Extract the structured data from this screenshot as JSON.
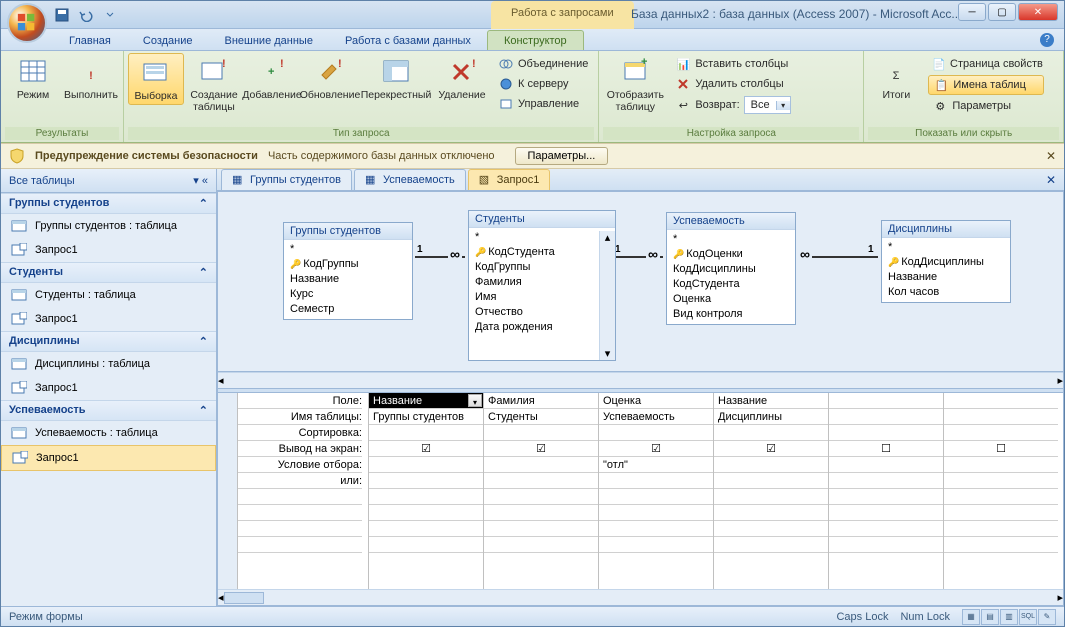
{
  "title_bar": {
    "context_tab": "Работа с запросами",
    "app_title": "База данных2 : база данных (Access 2007) - Microsoft Acc..."
  },
  "ribbon_tabs": [
    "Главная",
    "Создание",
    "Внешние данные",
    "Работа с базами данных",
    "Конструктор"
  ],
  "ribbon_active_tab": 4,
  "ribbon": {
    "group_results": {
      "label": "Результаты",
      "mode": "Режим",
      "run": "Выполнить"
    },
    "group_querytype": {
      "label": "Тип запроса",
      "select": "Выборка",
      "maketable": "Создание таблицы",
      "append": "Добавление",
      "update": "Обновление",
      "crosstab": "Перекрестный",
      "delete": "Удаление",
      "union": "Объединение",
      "passthrough": "К серверу",
      "ddl": "Управление"
    },
    "group_setup": {
      "label": "Настройка запроса",
      "showtable": "Отобразить таблицу",
      "insertcols": "Вставить столбцы",
      "deletecols": "Удалить столбцы",
      "return": "Возврат:",
      "return_val": "Все"
    },
    "group_showhide": {
      "label": "Показать или скрыть",
      "totals": "Итоги",
      "propsheet": "Страница свойств",
      "tablenames": "Имена таблиц",
      "params": "Параметры"
    }
  },
  "security": {
    "heading": "Предупреждение системы безопасности",
    "text": "Часть содержимого базы данных отключено",
    "btn": "Параметры..."
  },
  "nav": {
    "header": "Все таблицы",
    "groups": [
      {
        "name": "Группы студентов",
        "items": [
          {
            "type": "table",
            "label": "Группы студентов : таблица"
          },
          {
            "type": "query",
            "label": "Запрос1"
          }
        ]
      },
      {
        "name": "Студенты",
        "items": [
          {
            "type": "table",
            "label": "Студенты : таблица"
          },
          {
            "type": "query",
            "label": "Запрос1"
          }
        ]
      },
      {
        "name": "Дисциплины",
        "items": [
          {
            "type": "table",
            "label": "Дисциплины : таблица"
          },
          {
            "type": "query",
            "label": "Запрос1"
          }
        ]
      },
      {
        "name": "Успеваемость",
        "items": [
          {
            "type": "table",
            "label": "Успеваемость : таблица"
          },
          {
            "type": "query",
            "label": "Запрос1",
            "selected": true
          }
        ]
      }
    ]
  },
  "doc_tabs": [
    {
      "label": "Группы студентов",
      "type": "table"
    },
    {
      "label": "Успеваемость",
      "type": "table"
    },
    {
      "label": "Запрос1",
      "type": "query",
      "active": true
    }
  ],
  "tables": [
    {
      "title": "Группы студентов",
      "star": "*",
      "fields": [
        {
          "n": "КодГруппы",
          "pk": true
        },
        {
          "n": "Название"
        },
        {
          "n": "Курс"
        },
        {
          "n": "Семестр"
        }
      ]
    },
    {
      "title": "Студенты",
      "star": "*",
      "fields": [
        {
          "n": "КодСтудента",
          "pk": true
        },
        {
          "n": "КодГруппы"
        },
        {
          "n": "Фамилия"
        },
        {
          "n": "Имя"
        },
        {
          "n": "Отчество"
        },
        {
          "n": "Дата рождения"
        }
      ]
    },
    {
      "title": "Успеваемость",
      "star": "*",
      "fields": [
        {
          "n": "КодОценки",
          "pk": true
        },
        {
          "n": "КодДисциплины"
        },
        {
          "n": "КодСтудента"
        },
        {
          "n": "Оценка"
        },
        {
          "n": "Вид контроля"
        }
      ]
    },
    {
      "title": "Дисциплины",
      "star": "*",
      "fields": [
        {
          "n": "КодДисциплины",
          "pk": true
        },
        {
          "n": "Название"
        },
        {
          "n": "Кол часов"
        }
      ]
    }
  ],
  "grid": {
    "row_labels": {
      "field": "Поле:",
      "table": "Имя таблицы:",
      "sort": "Сортировка:",
      "show": "Вывод на экран:",
      "criteria": "Условие отбора:",
      "or": "или:"
    },
    "columns": [
      {
        "field": "Название",
        "table": "Группы студентов",
        "show": true,
        "criteria": ""
      },
      {
        "field": "Фамилия",
        "table": "Студенты",
        "show": true,
        "criteria": ""
      },
      {
        "field": "Оценка",
        "table": "Успеваемость",
        "show": true,
        "criteria": "\"отл\""
      },
      {
        "field": "Название",
        "table": "Дисциплины",
        "show": true,
        "criteria": ""
      },
      {
        "field": "",
        "table": "",
        "show": false,
        "criteria": ""
      },
      {
        "field": "",
        "table": "",
        "show": false,
        "criteria": ""
      }
    ]
  },
  "status": {
    "mode": "Режим формы",
    "caps": "Caps Lock",
    "num": "Num Lock"
  }
}
